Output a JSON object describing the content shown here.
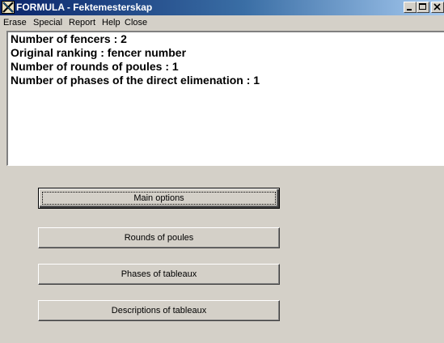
{
  "window": {
    "title": "FORMULA - Fektemesterskap",
    "icon": "formula-app-icon"
  },
  "menu": {
    "items": [
      "Erase",
      "Special",
      "Report",
      "Help",
      "Close"
    ]
  },
  "info": {
    "lines": [
      "Number of fencers : 2",
      "Original ranking : fencer number",
      "Number of rounds of poules : 1",
      "Number of phases of the direct elimenation : 1"
    ]
  },
  "buttons": {
    "main_options": "Main options",
    "rounds_of_poules": "Rounds of poules",
    "phases_of_tableaux": "Phases of tableaux",
    "descriptions_of_tableaux": "Descriptions of tableaux"
  }
}
